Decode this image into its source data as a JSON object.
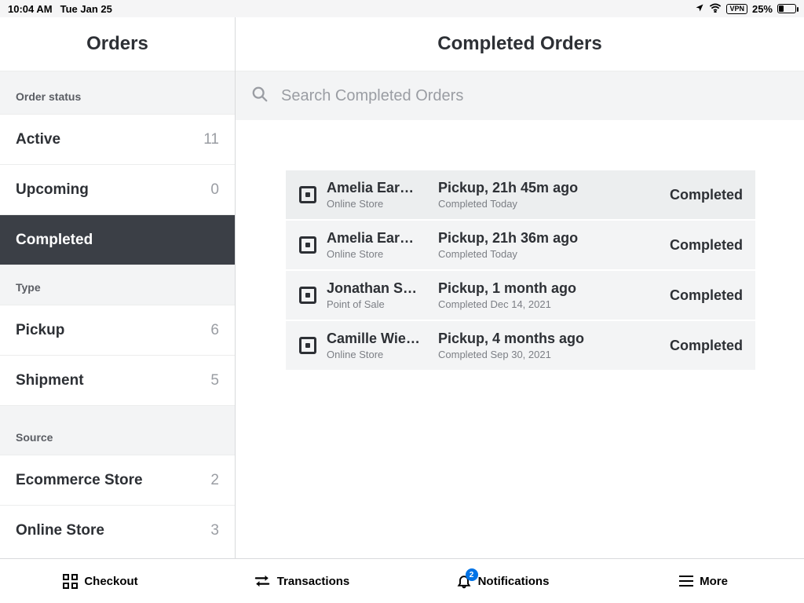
{
  "statusbar": {
    "time": "10:04 AM",
    "date": "Tue Jan 25",
    "vpn": "VPN",
    "battery_pct": "25%"
  },
  "sidebar": {
    "title": "Orders",
    "sections": {
      "status_label": "Order status",
      "type_label": "Type",
      "source_label": "Source"
    },
    "status_items": [
      {
        "label": "Active",
        "count": "11"
      },
      {
        "label": "Upcoming",
        "count": "0"
      },
      {
        "label": "Completed",
        "count": ""
      }
    ],
    "type_items": [
      {
        "label": "Pickup",
        "count": "6"
      },
      {
        "label": "Shipment",
        "count": "5"
      }
    ],
    "source_items": [
      {
        "label": "Ecommerce Store",
        "count": "2"
      },
      {
        "label": "Online Store",
        "count": "3"
      }
    ]
  },
  "main": {
    "title": "Completed Orders",
    "search_placeholder": "Search Completed Orders"
  },
  "orders": [
    {
      "name": "Amelia Ear…",
      "source": "Online Store",
      "info": "Pickup, 21h 45m ago",
      "completed": "Completed Today",
      "status": "Completed"
    },
    {
      "name": "Amelia Ear…",
      "source": "Online Store",
      "info": "Pickup, 21h 36m ago",
      "completed": "Completed Today",
      "status": "Completed"
    },
    {
      "name": "Jonathan S…",
      "source": "Point of Sale",
      "info": "Pickup, 1 month ago",
      "completed": "Completed Dec 14, 2021",
      "status": "Completed"
    },
    {
      "name": "Camille Wie…",
      "source": "Online Store",
      "info": "Pickup, 4 months ago",
      "completed": "Completed Sep 30, 2021",
      "status": "Completed"
    }
  ],
  "bottomnav": {
    "checkout": "Checkout",
    "transactions": "Transactions",
    "notifications": "Notifications",
    "notifications_badge": "2",
    "more": "More"
  }
}
